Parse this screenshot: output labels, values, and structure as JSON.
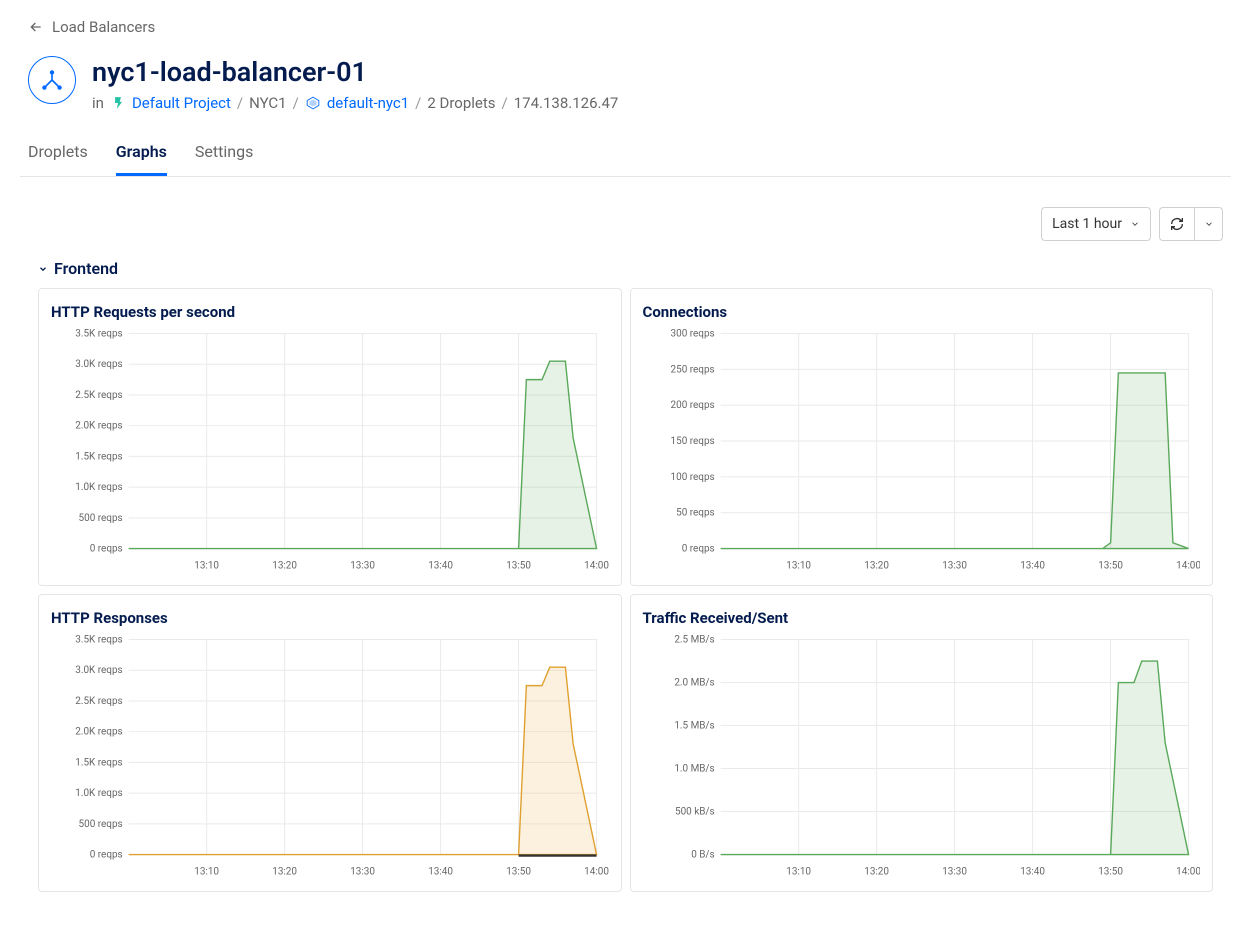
{
  "back": {
    "label": "Load Balancers"
  },
  "header": {
    "title": "nyc1-load-balancer-01",
    "in": "in",
    "project": "Default Project",
    "region": "NYC1",
    "network": "default-nyc1",
    "droplets": "2 Droplets",
    "ip": "174.138.126.47"
  },
  "tabs": {
    "droplets": "Droplets",
    "graphs": "Graphs",
    "settings": "Settings",
    "active": "graphs"
  },
  "controls": {
    "timerange": "Last 1 hour"
  },
  "section": {
    "frontend": "Frontend"
  },
  "colors": {
    "green": "#5aa85a",
    "orange": "#e0a030"
  },
  "chart_data": [
    {
      "id": "http-req",
      "title": "HTTP Requests per second",
      "type": "area",
      "color": "green",
      "x_ticks": [
        "13:10",
        "13:20",
        "13:30",
        "13:40",
        "13:50",
        "14:00"
      ],
      "y_ticks": [
        "0 reqps",
        "500 reqps",
        "1.0K reqps",
        "1.5K reqps",
        "2.0K reqps",
        "2.5K reqps",
        "3.0K reqps",
        "3.5K reqps"
      ],
      "ylim": [
        0,
        3500
      ],
      "x": [
        0,
        50,
        51,
        53,
        54,
        56,
        57,
        60
      ],
      "y": [
        0,
        0,
        2750,
        2750,
        3050,
        3050,
        1800,
        0
      ]
    },
    {
      "id": "connections",
      "title": "Connections",
      "type": "area",
      "color": "green",
      "x_ticks": [
        "13:10",
        "13:20",
        "13:30",
        "13:40",
        "13:50",
        "14:00"
      ],
      "y_ticks": [
        "0 reqps",
        "50 reqps",
        "100 reqps",
        "150 reqps",
        "200 reqps",
        "250 reqps",
        "300 reqps"
      ],
      "ylim": [
        0,
        300
      ],
      "x": [
        0,
        49,
        50,
        51,
        57,
        58,
        60
      ],
      "y": [
        0,
        0,
        8,
        245,
        245,
        8,
        0
      ]
    },
    {
      "id": "http-resp",
      "title": "HTTP Responses",
      "type": "area",
      "color": "orange",
      "x_ticks": [
        "13:10",
        "13:20",
        "13:30",
        "13:40",
        "13:50",
        "14:00"
      ],
      "y_ticks": [
        "0 reqps",
        "500 reqps",
        "1.0K reqps",
        "1.5K reqps",
        "2.0K reqps",
        "2.5K reqps",
        "3.0K reqps",
        "3.5K reqps"
      ],
      "ylim": [
        0,
        3500
      ],
      "x": [
        0,
        50,
        51,
        53,
        54,
        56,
        57,
        60
      ],
      "y": [
        0,
        0,
        2750,
        2750,
        3050,
        3050,
        1800,
        0
      ],
      "baseline": true
    },
    {
      "id": "traffic",
      "title": "Traffic Received/Sent",
      "type": "area",
      "color": "green",
      "x_ticks": [
        "13:10",
        "13:20",
        "13:30",
        "13:40",
        "13:50",
        "14:00"
      ],
      "y_ticks": [
        "0 B/s",
        "500 kB/s",
        "1.0 MB/s",
        "1.5 MB/s",
        "2.0 MB/s",
        "2.5 MB/s"
      ],
      "ylim": [
        0,
        2.5
      ],
      "x": [
        0,
        50,
        51,
        53,
        54,
        56,
        57,
        60
      ],
      "y": [
        0,
        0,
        2.0,
        2.0,
        2.25,
        2.25,
        1.3,
        0
      ]
    }
  ]
}
